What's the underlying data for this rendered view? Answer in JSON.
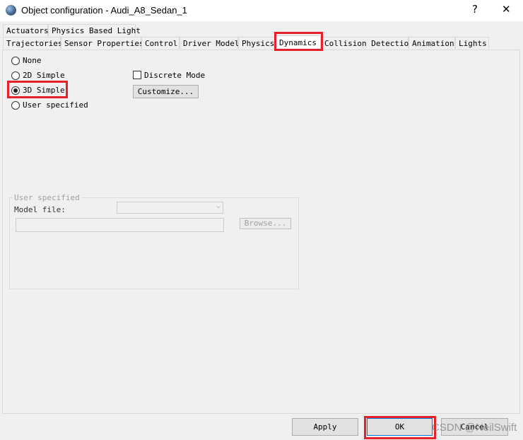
{
  "window": {
    "title": "Object configuration - Audi_A8_Sedan_1",
    "help": "?",
    "close": "✕"
  },
  "tabs_row1": [
    "Actuators",
    "Physics Based Light"
  ],
  "tabs_row2": [
    "Trajectories",
    "Sensor Properties",
    "Control",
    "Driver Model",
    "Physics",
    "Dynamics",
    "Collision Detection",
    "Animation",
    "Lights"
  ],
  "selected_tab": "Dynamics",
  "dynamics": {
    "options": [
      "None",
      "2D Simple",
      "3D Simple",
      "User specified"
    ],
    "selected": "3D Simple",
    "discrete_mode": {
      "label": "Discrete Mode",
      "checked": false
    },
    "customize": "Customize...",
    "user_group": {
      "title": "User specified",
      "model_file_label": "Model file:",
      "model_file_value": "",
      "path_value": "",
      "browse": "Browse..."
    }
  },
  "buttons": {
    "apply": "Apply",
    "ok": "OK",
    "cancel": "Cancel"
  },
  "watermark": "CSDN @NeilSwift",
  "highlight_color": "#e8202a"
}
